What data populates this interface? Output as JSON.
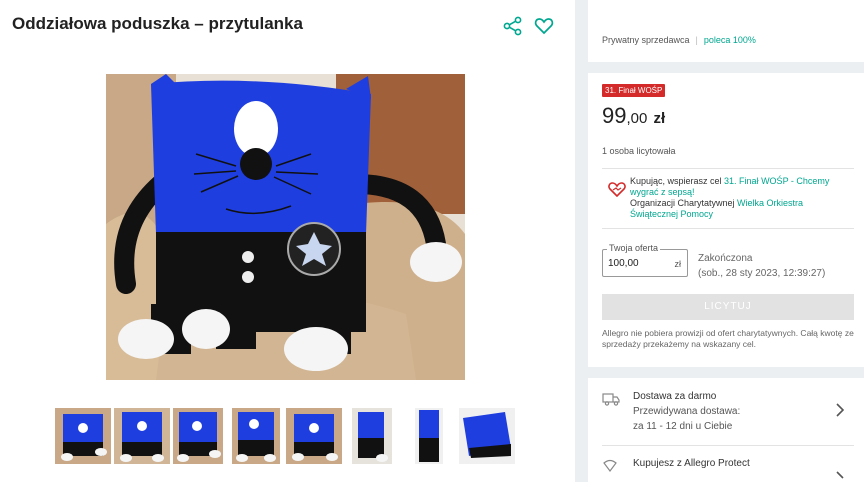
{
  "product": {
    "title": "Oddziałowa poduszka – przytulanka"
  },
  "icons": {
    "share": "share-icon",
    "favorite": "heart-outline-icon",
    "charity": "heart-charity-icon",
    "delivery": "truck-icon",
    "protect": "shield-icon",
    "chevron": "chevron-right-icon"
  },
  "seller": {
    "type": "Prywatny sprzedawca",
    "recommend": "poleca 100%"
  },
  "offer": {
    "badge": "31. Finał WOŚP",
    "price_main": "99",
    "price_cents": ",00",
    "currency": "zł",
    "bidders": "1 osoba licytowała"
  },
  "charity": {
    "line1": "Kupując, wspierasz cel ",
    "goal_link": "31. Finał WOŚP - Chcemy wygrać z sepsą!",
    "line2": "Organizacji Charytatywnej ",
    "org_link": "Wielka Orkiestra Świątecznej Pomocy"
  },
  "bid": {
    "label": "Twoja oferta",
    "value": "100,00",
    "currency": "zł",
    "status": "Zakończona",
    "end_date": "(sob., 28 sty 2023, 12:39:27)",
    "button": "LICYTUJ"
  },
  "note": "Allegro nie pobiera prowizji od ofert charytatywnych. Całą kwotę ze sprzedaży przekażemy na wskazany cel.",
  "delivery": {
    "title": "Dostawa za darmo",
    "line2": "Przewidywana dostawa:",
    "line3": "za 11 - 12 dni u Ciebie"
  },
  "protect": {
    "title": "Kupujesz z Allegro Protect"
  },
  "colors": {
    "accent": "#00a790",
    "badge": "#d42a2a",
    "pillow_blue": "#1f3ee0",
    "pillow_black": "#111111",
    "chair_tan": "#c8a886"
  }
}
